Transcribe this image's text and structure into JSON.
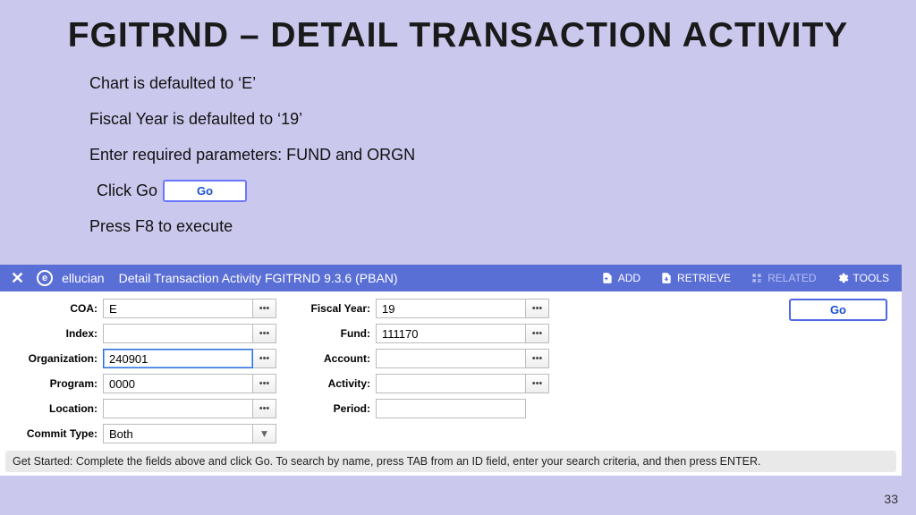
{
  "slide": {
    "title": "FGITRND – DETAIL TRANSACTION ACTIVITY",
    "bullets": {
      "b1": "Chart is defaulted to ‘E’",
      "b2": "Fiscal Year is defaulted to ‘19’",
      "b3": "Enter required parameters: FUND and ORGN",
      "b4_prefix": "Click Go",
      "b4_button": "Go",
      "b5": "Press F8 to execute"
    },
    "page_num": "33"
  },
  "app": {
    "brand": "ellucian",
    "title": "Detail Transaction Activity FGITRND 9.3.6 (PBAN)",
    "header_buttons": {
      "add": "ADD",
      "retrieve": "RETRIEVE",
      "related": "RELATED",
      "tools": "TOOLS"
    },
    "labels": {
      "coa": "COA:",
      "index": "Index:",
      "organization": "Organization:",
      "program": "Program:",
      "location": "Location:",
      "commit_type": "Commit Type:",
      "fiscal_year": "Fiscal Year:",
      "fund": "Fund:",
      "account": "Account:",
      "activity": "Activity:",
      "period": "Period:"
    },
    "values": {
      "coa": "E",
      "index": "",
      "organization": "240901",
      "program": "0000",
      "location": "",
      "commit_type": "Both",
      "fiscal_year": "19",
      "fund": "111170",
      "account": "",
      "activity": "",
      "period": ""
    },
    "ellipsis": "•••",
    "go_label": "Go",
    "hint": "Get Started: Complete the fields above and click Go. To search by name, press TAB from an ID field, enter your search criteria, and then press ENTER."
  }
}
